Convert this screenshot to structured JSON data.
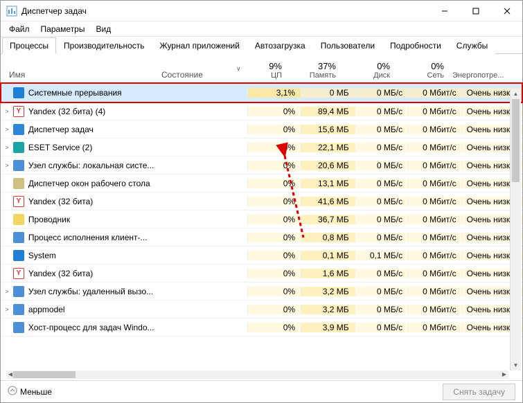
{
  "window": {
    "title": "Диспетчер задач"
  },
  "menu": {
    "file": "Файл",
    "options": "Параметры",
    "view": "Вид"
  },
  "tabs": {
    "processes": "Процессы",
    "performance": "Производительность",
    "app_history": "Журнал приложений",
    "startup": "Автозагрузка",
    "users": "Пользователи",
    "details": "Подробности",
    "services": "Службы"
  },
  "columns": {
    "name": "Имя",
    "state": "Состояние",
    "cpu_pct": "9%",
    "cpu": "ЦП",
    "mem_pct": "37%",
    "mem": "Память",
    "disk_pct": "0%",
    "disk": "Диск",
    "net_pct": "0%",
    "net": "Сеть",
    "power": "Энергопотре..."
  },
  "rows": [
    {
      "icon": "ic-sys",
      "exp": "",
      "name": "Системные прерывания",
      "cpu": "3,1%",
      "mem": "0 МБ",
      "disk": "0 МБ/с",
      "net": "0 Мбит/с",
      "power": "Очень низкое",
      "hl": true
    },
    {
      "icon": "ic-yandex",
      "exp": ">",
      "name": "Yandex (32 бита) (4)",
      "cpu": "0%",
      "mem": "89,4 МБ",
      "disk": "0 МБ/с",
      "net": "0 Мбит/с",
      "power": "Очень низкое"
    },
    {
      "icon": "ic-tm",
      "exp": ">",
      "name": "Диспетчер задач",
      "cpu": "0%",
      "mem": "15,6 МБ",
      "disk": "0 МБ/с",
      "net": "0 Мбит/с",
      "power": "Очень низкое"
    },
    {
      "icon": "ic-eset",
      "exp": ">",
      "name": "ESET Service (2)",
      "cpu": "0%",
      "mem": "22,1 МБ",
      "disk": "0 МБ/с",
      "net": "0 Мбит/с",
      "power": "Очень низкое"
    },
    {
      "icon": "ic-svc",
      "exp": ">",
      "name": "Узел службы: локальная систе...",
      "cpu": "0%",
      "mem": "20,6 МБ",
      "disk": "0 МБ/с",
      "net": "0 Мбит/с",
      "power": "Очень низкое"
    },
    {
      "icon": "ic-dwm",
      "exp": "",
      "name": "Диспетчер окон рабочего стола",
      "cpu": "0%",
      "mem": "13,1 МБ",
      "disk": "0 МБ/с",
      "net": "0 Мбит/с",
      "power": "Очень низкое"
    },
    {
      "icon": "ic-yandex",
      "exp": "",
      "name": "Yandex (32 бита)",
      "cpu": "0%",
      "mem": "41,6 МБ",
      "disk": "0 МБ/с",
      "net": "0 Мбит/с",
      "power": "Очень низкое"
    },
    {
      "icon": "ic-explorer",
      "exp": "",
      "name": "Проводник",
      "cpu": "0%",
      "mem": "36,7 МБ",
      "disk": "0 МБ/с",
      "net": "0 Мбит/с",
      "power": "Очень низкое"
    },
    {
      "icon": "ic-generic",
      "exp": "",
      "name": "Процесс исполнения клиент-...",
      "cpu": "0%",
      "mem": "0,8 МБ",
      "disk": "0 МБ/с",
      "net": "0 Мбит/с",
      "power": "Очень низкое"
    },
    {
      "icon": "ic-sys",
      "exp": "",
      "name": "System",
      "cpu": "0%",
      "mem": "0,1 МБ",
      "disk": "0,1 МБ/с",
      "net": "0 Мбит/с",
      "power": "Очень низкое"
    },
    {
      "icon": "ic-yandex",
      "exp": "",
      "name": "Yandex (32 бита)",
      "cpu": "0%",
      "mem": "1,6 МБ",
      "disk": "0 МБ/с",
      "net": "0 Мбит/с",
      "power": "Очень низкое"
    },
    {
      "icon": "ic-svc",
      "exp": ">",
      "name": "Узел службы: удаленный вызо...",
      "cpu": "0%",
      "mem": "3,2 МБ",
      "disk": "0 МБ/с",
      "net": "0 Мбит/с",
      "power": "Очень низкое"
    },
    {
      "icon": "ic-svc",
      "exp": ">",
      "name": "appmodel",
      "cpu": "0%",
      "mem": "3,2 МБ",
      "disk": "0 МБ/с",
      "net": "0 Мбит/с",
      "power": "Очень низкое"
    },
    {
      "icon": "ic-generic",
      "exp": "",
      "name": "Хост-процесс для задач Windo...",
      "cpu": "0%",
      "mem": "3,9 МБ",
      "disk": "0 МБ/с",
      "net": "0 Мбит/с",
      "power": "Очень низкое"
    }
  ],
  "footer": {
    "less": "Меньше",
    "end_task": "Снять задачу"
  }
}
